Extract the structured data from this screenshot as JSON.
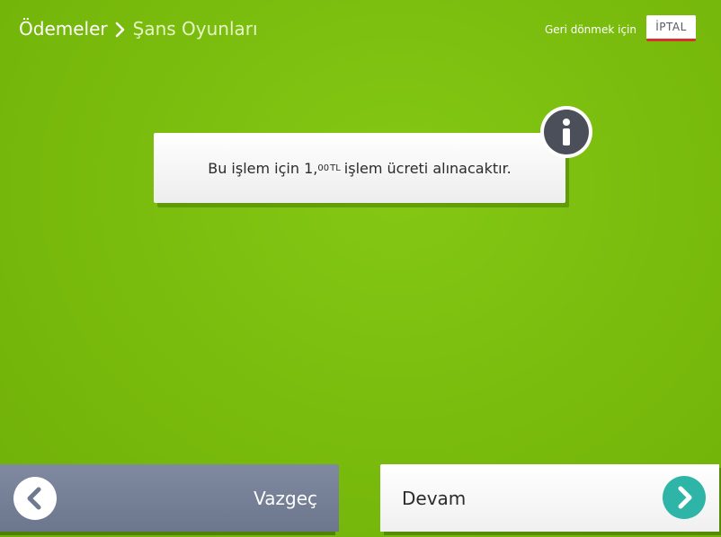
{
  "header": {
    "breadcrumb_root": "Ödemeler",
    "breadcrumb_current": "Şans Oyunları",
    "back_hint": "Geri dönmek için",
    "cancel_label": "İPTAL"
  },
  "info": {
    "text_before": "Bu işlem için",
    "amount_integer": "1,",
    "amount_decimal": "00",
    "currency": "TL",
    "text_after": "işlem ücreti alınacaktır.",
    "icon": "info-icon"
  },
  "footer": {
    "cancel_label": "Vazgeç",
    "cancel_icon": "chevron-left-icon",
    "continue_label": "Devam",
    "continue_icon": "chevron-right-icon"
  },
  "colors": {
    "background": "#7bbd0e",
    "cancel_button": "#737e95",
    "continue_icon": "#2eb5a8",
    "info_icon": "#4b4f59",
    "cancel_underline": "#d9302b"
  }
}
